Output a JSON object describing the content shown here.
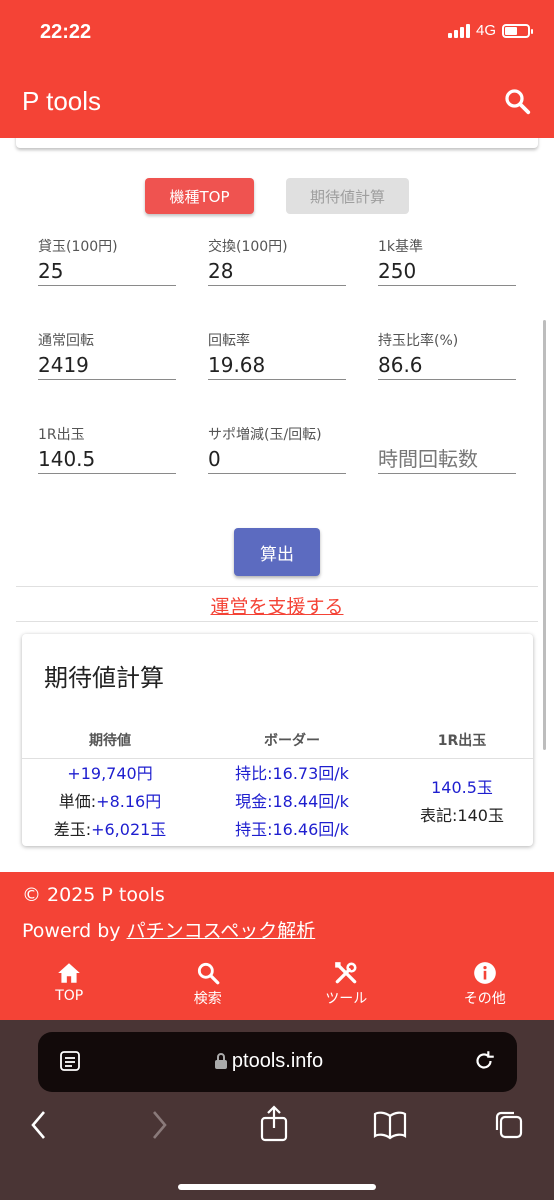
{
  "status": {
    "time": "22:22",
    "network": "4G"
  },
  "app": {
    "title": "P tools"
  },
  "tabs": {
    "kishu_top": "機種TOP",
    "kitaichi": "期待値計算"
  },
  "form": {
    "kashidama_label": "貸玉(100円)",
    "kashidama_value": "25",
    "koukan_label": "交換(100円)",
    "koukan_value": "28",
    "kijun_label": "1k基準",
    "kijun_value": "250",
    "tsujo_label": "通常回転",
    "tsujo_value": "2419",
    "kaitenritsu_label": "回転率",
    "kaitenritsu_value": "19.68",
    "mochidama_label": "持玉比率(%)",
    "mochidama_value": "86.6",
    "shutsudama_label": "1R出玉",
    "shutsudama_value": "140.5",
    "sapo_label": "サポ増減(玉/回転)",
    "sapo_value": "0",
    "jikan_placeholder": "時間回転数",
    "calc_button": "算出"
  },
  "support_link": "運営を支援する",
  "result": {
    "title": "期待値計算",
    "headers": [
      "期待値",
      "ボーダー",
      "1R出玉"
    ],
    "kitaichi": [
      "+19,740円",
      "単価:",
      "+8.16円",
      "差玉:",
      "+6,021玉"
    ],
    "border": [
      "持比:16.73回/k",
      "現金:18.44回/k",
      "持玉:16.46回/k"
    ],
    "round": [
      "140.5玉",
      "表記:140玉"
    ]
  },
  "footer": {
    "copyright": "© 2025 P tools",
    "powered_prefix": "Powerd by ",
    "powered_link": "パチンコスペック解析"
  },
  "nav": {
    "top": "TOP",
    "search": "検索",
    "tools": "ツール",
    "other": "その他"
  },
  "browser": {
    "url": "ptools.info"
  },
  "colors": {
    "primary": "#f44336",
    "accent_button": "#5c6bc0",
    "value_blue": "#1e1ecf"
  }
}
